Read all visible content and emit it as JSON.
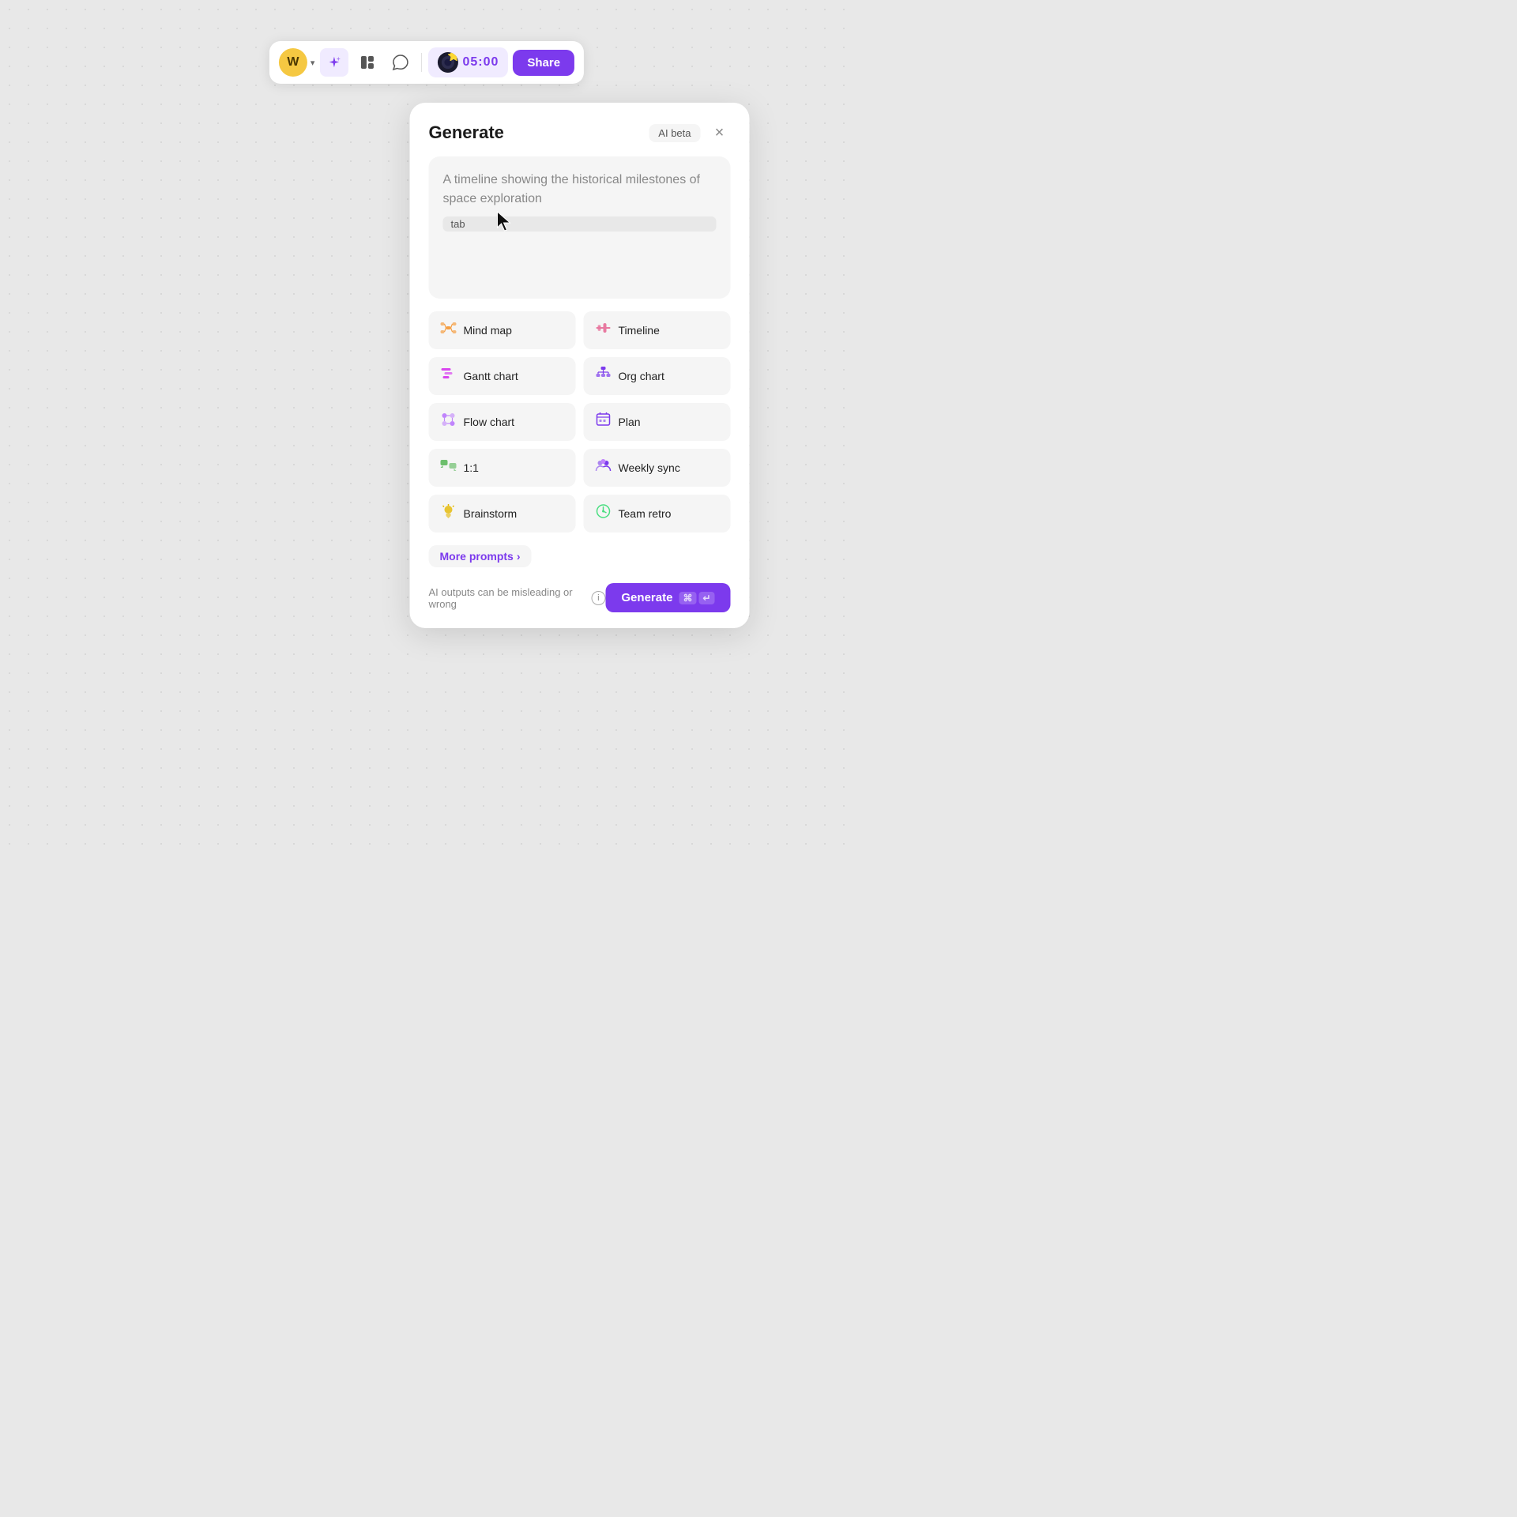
{
  "toolbar": {
    "user_initial": "W",
    "ai_label": "✦",
    "layout_icon": "▦",
    "chat_icon": "○",
    "timer_display": "05:00",
    "share_label": "Share"
  },
  "panel": {
    "title": "Generate",
    "ai_beta_label": "AI beta",
    "close_label": "×",
    "prompt_placeholder": "A timeline showing the historical milestones of space exploration",
    "tab_key_label": "tab",
    "suggestions": [
      {
        "id": "mindmap",
        "label": "Mind map",
        "icon": "🧩"
      },
      {
        "id": "timeline",
        "label": "Timeline",
        "icon": "📊"
      },
      {
        "id": "gantt",
        "label": "Gantt chart",
        "icon": "📋"
      },
      {
        "id": "orgchart",
        "label": "Org chart",
        "icon": "🏢"
      },
      {
        "id": "flowchart",
        "label": "Flow chart",
        "icon": "🔀"
      },
      {
        "id": "plan",
        "label": "Plan",
        "icon": "📅"
      },
      {
        "id": "oneone",
        "label": "1:1",
        "icon": "💬"
      },
      {
        "id": "weeklysync",
        "label": "Weekly sync",
        "icon": "👥"
      },
      {
        "id": "brainstorm",
        "label": "Brainstorm",
        "icon": "💡"
      },
      {
        "id": "teamretro",
        "label": "Team retro",
        "icon": "🕐"
      }
    ],
    "more_prompts_label": "More prompts",
    "more_prompts_arrow": "›",
    "disclaimer": "AI outputs can be misleading or wrong",
    "generate_label": "Generate",
    "kbd_cmd": "⌘",
    "kbd_enter": "↵"
  }
}
